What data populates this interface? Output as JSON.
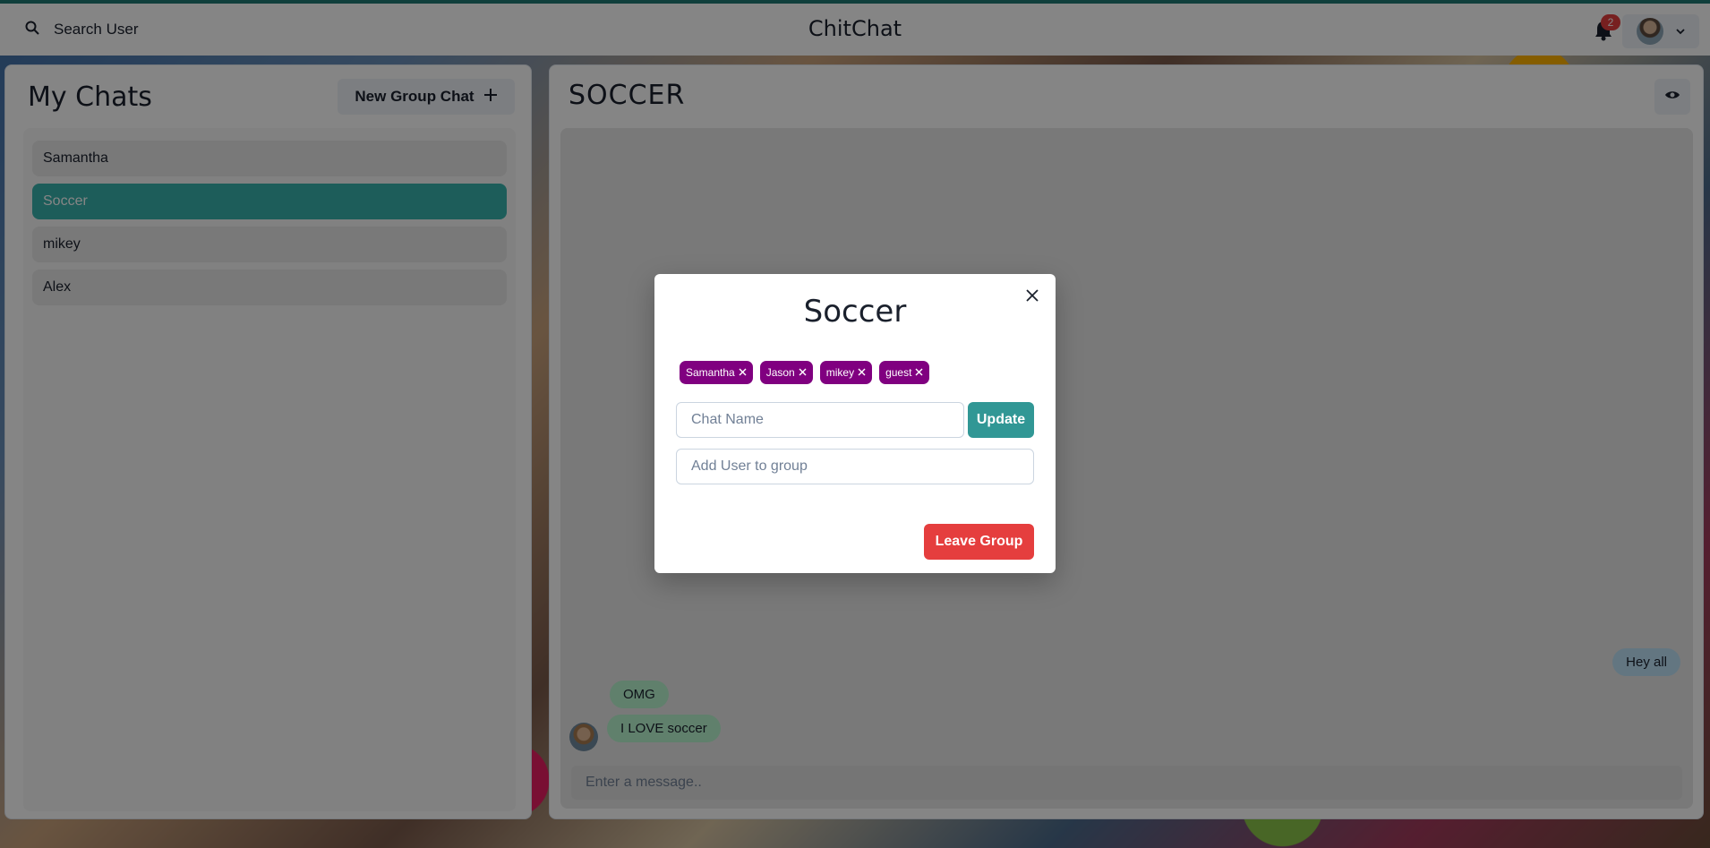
{
  "header": {
    "search_label": "Search User",
    "app_title": "ChitChat",
    "notification_count": "2"
  },
  "sidebar": {
    "title": "My Chats",
    "new_group_label": "New Group Chat",
    "chats": [
      {
        "label": "Samantha",
        "active": false
      },
      {
        "label": "Soccer",
        "active": true
      },
      {
        "label": "mikey",
        "active": false
      },
      {
        "label": "Alex",
        "active": false
      }
    ]
  },
  "chat": {
    "title": "SOCCER",
    "messages": [
      {
        "text": "Hey all",
        "mine": true
      },
      {
        "text": "OMG",
        "mine": false
      },
      {
        "text": "I LOVE soccer",
        "mine": false
      }
    ],
    "input_placeholder": "Enter a message.."
  },
  "modal": {
    "title": "Soccer",
    "members": [
      "Samantha",
      "Jason",
      "mikey",
      "guest"
    ],
    "chat_name_placeholder": "Chat Name",
    "update_label": "Update",
    "add_user_placeholder": "Add User to group",
    "leave_label": "Leave Group"
  },
  "colors": {
    "accent": "#38b2ac",
    "tag": "#800080",
    "danger": "#e53e3e",
    "my_bubble": "#bee3f8",
    "their_bubble": "#b9f5d0"
  }
}
